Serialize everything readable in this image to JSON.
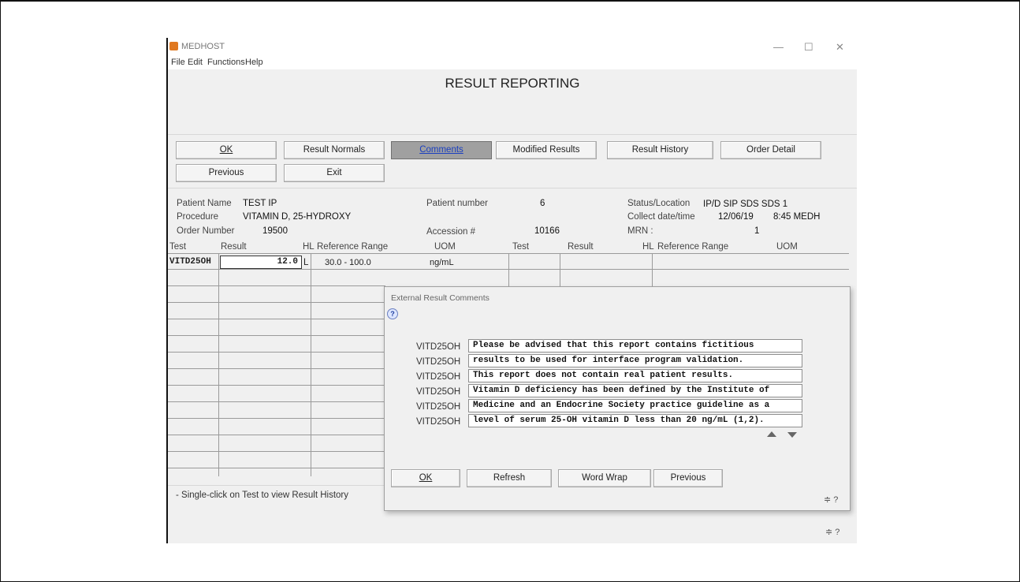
{
  "window": {
    "title": "MEDHOST",
    "minimize_glyph": "—",
    "maximize_glyph": "☐",
    "close_glyph": "✕"
  },
  "menu": [
    "File",
    "Edit",
    "Functions",
    "Help"
  ],
  "page_title": "RESULT REPORTING",
  "buttons": {
    "ok": "OK",
    "result_normals": "Result Normals",
    "comments": "Comments",
    "modified_results": "Modified Results",
    "result_history": "Result History",
    "order_detail": "Order Detail",
    "previous": "Previous",
    "exit": "Exit"
  },
  "patient": {
    "name_label": "Patient Name",
    "name": "TEST IP",
    "procedure_label": "Procedure",
    "procedure": "VITAMIN D, 25-HYDROXY",
    "order_number_label": "Order Number",
    "order_number": "19500",
    "patient_number_label": "Patient number",
    "patient_number": "6",
    "accession_label": "Accession #",
    "accession": "10166",
    "status_label": "Status/Location",
    "status": "IP/D SIP SDS SDS 1",
    "collect_label": "Collect date/time",
    "collect_date": "12/06/19",
    "collect_time": "8:45 MEDH",
    "mrn_label": "MRN :",
    "mrn": "1"
  },
  "grid": {
    "headers_left": [
      "Test",
      "Result",
      "HL",
      "Reference Range",
      "UOM"
    ],
    "headers_right": [
      "Test",
      "Result",
      "HL",
      "Reference Range",
      "UOM"
    ],
    "row": {
      "test": "VITD25OH",
      "result": "12.0",
      "hl": "L",
      "range": "30.0 - 100.0",
      "uom": "ng/mL"
    }
  },
  "footnote": "- Single-click on Test to view Result History",
  "dialog": {
    "title": "External Result Comments",
    "help_glyph": "?",
    "comments": [
      {
        "code": "VITD25OH",
        "text": "Please be advised that this report contains fictitious"
      },
      {
        "code": "VITD25OH",
        "text": "results to be used for interface program validation."
      },
      {
        "code": "VITD25OH",
        "text": "This report does not contain real patient results."
      },
      {
        "code": "VITD25OH",
        "text": "Vitamin D deficiency has been defined by the Institute of"
      },
      {
        "code": "VITD25OH",
        "text": "Medicine and an Endocrine Society practice guideline as a"
      },
      {
        "code": "VITD25OH",
        "text": "level of serum 25-OH vitamin D less than 20 ng/mL (1,2)."
      }
    ],
    "buttons": {
      "ok": "OK",
      "refresh": "Refresh",
      "word_wrap": "Word Wrap",
      "previous": "Previous"
    },
    "corner_glyph": "≑ ?"
  },
  "corner_glyph": "≑ ?"
}
